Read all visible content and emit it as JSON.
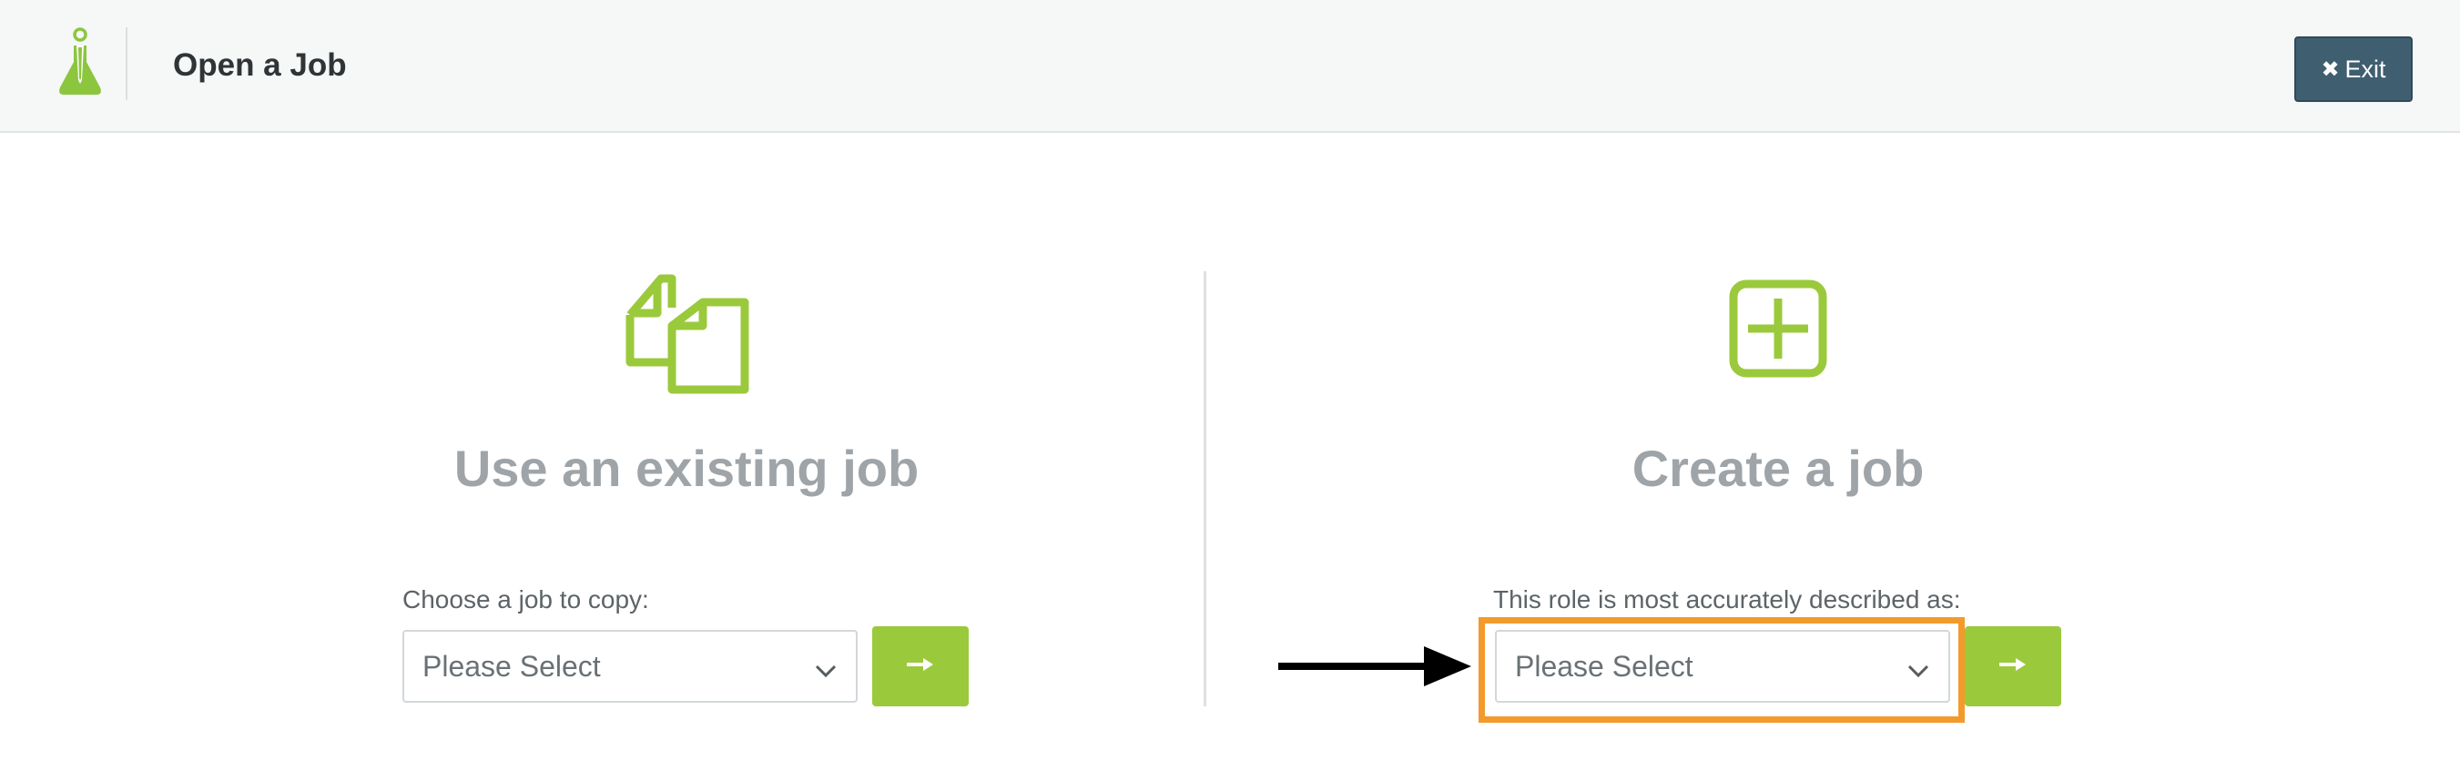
{
  "header": {
    "title": "Open a Job",
    "exit_label": "Exit",
    "logo_icon": "flask-logo-icon"
  },
  "existing_job": {
    "icon": "copy-documents-icon",
    "title": "Use an existing job",
    "label": "Choose a job to copy:",
    "select_value": "Please Select",
    "go_icon": "arrow-right-icon"
  },
  "create_job": {
    "icon": "plus-square-icon",
    "title": "Create a job",
    "label": "This role is most accurately described as:",
    "select_value": "Please Select",
    "go_icon": "arrow-right-icon"
  },
  "annotation": {
    "highlight_color": "#f39a2c",
    "arrow_color": "#000000"
  },
  "colors": {
    "accent_green": "#9bc93c",
    "exit_button": "#3f5f70",
    "title_gray": "#9ea4a8"
  }
}
